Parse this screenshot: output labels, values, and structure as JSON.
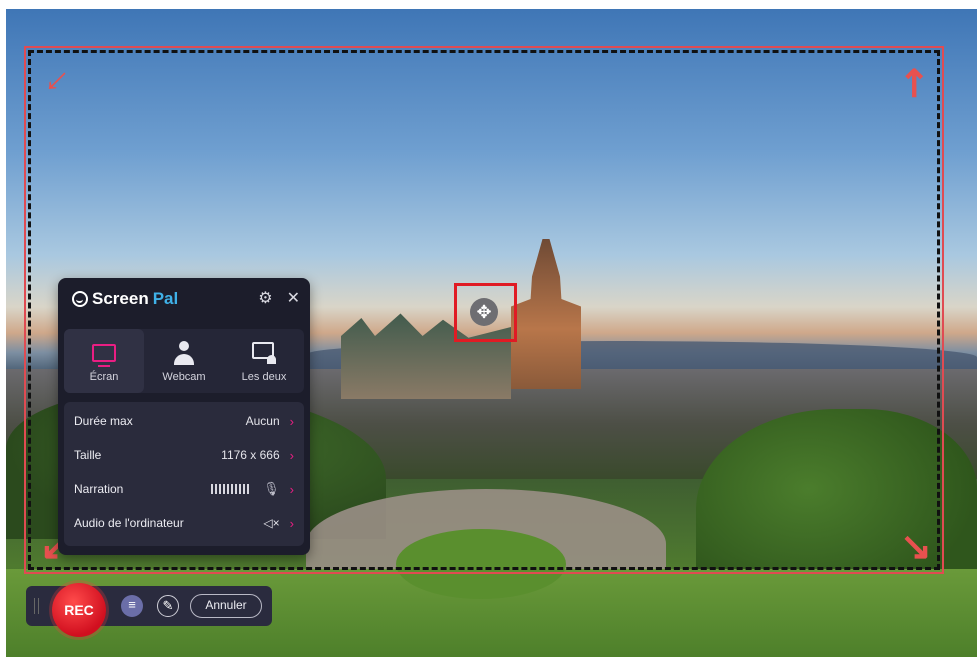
{
  "app": {
    "brand_screen": "Screen",
    "brand_pal": "Pal"
  },
  "modes": [
    {
      "label": "Écran",
      "icon": "monitor-icon",
      "selected": true
    },
    {
      "label": "Webcam",
      "icon": "person-icon",
      "selected": false
    },
    {
      "label": "Les deux",
      "icon": "monitor-person-icon",
      "selected": false
    }
  ],
  "settings": {
    "max_duration_label": "Durée max",
    "max_duration_value": "Aucun",
    "size_label": "Taille",
    "size_value": "1176 x 666",
    "narration_label": "Narration",
    "computer_audio_label": "Audio de l'ordinateur"
  },
  "toolbar": {
    "rec_label": "REC",
    "cancel_label": "Annuler"
  },
  "colors": {
    "accent": "#e91e83",
    "rec": "#d10f1f",
    "frame": "#e04b52",
    "panel_bg": "#1c1d2b"
  }
}
